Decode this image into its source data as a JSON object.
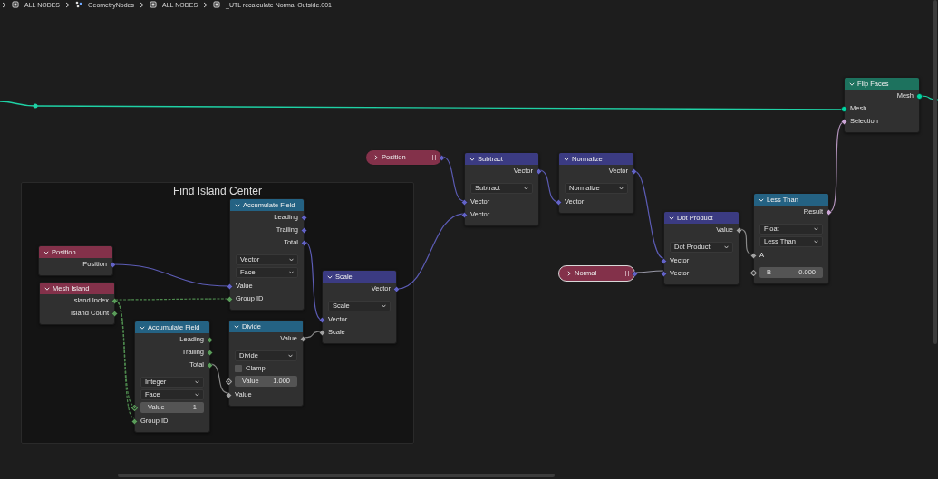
{
  "breadcrumbs": [
    {
      "label": "ALL NODES"
    },
    {
      "label": "GeometryNodes"
    },
    {
      "label": "ALL NODES"
    },
    {
      "label": "_UTL recalculate Normal Outside.001"
    }
  ],
  "frame": {
    "label": "Find Island Center"
  },
  "nodes": [
    {
      "kind": "node",
      "title": "Flip Faces",
      "color": "#1d725e",
      "rows": [
        {
          "kind": "output",
          "label": "Mesh",
          "socket": {
            "kind": "circle",
            "color": "#00d6a3"
          }
        },
        {
          "kind": "input",
          "label": "Mesh",
          "socket": {
            "kind": "circle",
            "color": "#00d6a3"
          }
        },
        {
          "kind": "input",
          "label": "Selection",
          "socket": {
            "kind": "diamond",
            "color": "#cca6d6"
          }
        }
      ]
    },
    {
      "kind": "pill",
      "title": "Position",
      "color": "#83314a",
      "selected": false,
      "socket": {
        "kind": "diamond",
        "color": "#6363c7"
      }
    },
    {
      "kind": "node",
      "title": "Subtract",
      "color": "#3b3b82",
      "rows": [
        {
          "kind": "output",
          "label": "Vector",
          "socket": {
            "kind": "diamond",
            "color": "#6363c7"
          }
        },
        {
          "kind": "dropdown",
          "value": "Subtract"
        },
        {
          "kind": "input",
          "label": "Vector",
          "socket": {
            "kind": "diamond",
            "color": "#6363c7"
          }
        },
        {
          "kind": "input",
          "label": "Vector",
          "socket": {
            "kind": "diamond",
            "color": "#6363c7"
          }
        }
      ]
    },
    {
      "kind": "node",
      "title": "Normalize",
      "color": "#3b3b82",
      "rows": [
        {
          "kind": "output",
          "label": "Vector",
          "socket": {
            "kind": "diamond",
            "color": "#6363c7"
          }
        },
        {
          "kind": "dropdown",
          "value": "Normalize"
        },
        {
          "kind": "input",
          "label": "Vector",
          "socket": {
            "kind": "diamond",
            "color": "#6363c7"
          }
        }
      ]
    },
    {
      "kind": "node",
      "title": "Accumulate Field",
      "color": "#246283",
      "rows": [
        {
          "kind": "output",
          "label": "Leading",
          "socket": {
            "kind": "diamond",
            "color": "#6363c7"
          }
        },
        {
          "kind": "output",
          "label": "Trailing",
          "socket": {
            "kind": "diamond",
            "color": "#6363c7"
          }
        },
        {
          "kind": "output",
          "label": "Total",
          "socket": {
            "kind": "diamond",
            "color": "#6363c7"
          }
        },
        {
          "kind": "dropdown",
          "value": "Vector"
        },
        {
          "kind": "dropdown",
          "value": "Face"
        },
        {
          "kind": "input",
          "label": "Value",
          "socket": {
            "kind": "diamond",
            "color": "#6363c7"
          }
        },
        {
          "kind": "input",
          "label": "Group ID",
          "socket": {
            "kind": "diamond",
            "color": "#5a9c5a"
          }
        }
      ]
    },
    {
      "kind": "node",
      "title": "Position",
      "color": "#83314a",
      "rows": [
        {
          "kind": "output",
          "label": "Position",
          "socket": {
            "kind": "diamond",
            "color": "#6363c7"
          }
        }
      ]
    },
    {
      "kind": "node",
      "title": "Mesh Island",
      "color": "#83314a",
      "rows": [
        {
          "kind": "output",
          "label": "Island Index",
          "socket": {
            "kind": "diamond",
            "color": "#5a9c5a"
          }
        },
        {
          "kind": "output",
          "label": "Island Count",
          "socket": {
            "kind": "diamond",
            "color": "#5a9c5a"
          }
        }
      ]
    },
    {
      "kind": "node",
      "title": "Scale",
      "color": "#3b3b82",
      "rows": [
        {
          "kind": "output",
          "label": "Vector",
          "socket": {
            "kind": "diamond",
            "color": "#6363c7"
          }
        },
        {
          "kind": "dropdown",
          "value": "Scale"
        },
        {
          "kind": "input",
          "label": "Vector",
          "socket": {
            "kind": "diamond",
            "color": "#6363c7"
          }
        },
        {
          "kind": "input",
          "label": "Scale",
          "socket": {
            "kind": "diamond",
            "color": "#a1a1a1"
          }
        }
      ]
    },
    {
      "kind": "node",
      "title": "Accumulate Field",
      "color": "#246283",
      "rows": [
        {
          "kind": "output",
          "label": "Leading",
          "socket": {
            "kind": "diamond",
            "color": "#5a9c5a"
          }
        },
        {
          "kind": "output",
          "label": "Trailing",
          "socket": {
            "kind": "diamond",
            "color": "#5a9c5a"
          }
        },
        {
          "kind": "output",
          "label": "Total",
          "socket": {
            "kind": "diamond",
            "color": "#5a9c5a"
          }
        },
        {
          "kind": "dropdown",
          "value": "Integer"
        },
        {
          "kind": "dropdown",
          "value": "Face"
        },
        {
          "kind": "field",
          "label": "Value",
          "value": "1",
          "socket": {
            "kind": "hollow",
            "color": "#5a9c5a"
          }
        },
        {
          "kind": "input",
          "label": "Group ID",
          "socket": {
            "kind": "diamond",
            "color": "#5a9c5a"
          }
        }
      ]
    },
    {
      "kind": "node",
      "title": "Divide",
      "color": "#246283",
      "rows": [
        {
          "kind": "output",
          "label": "Value",
          "socket": {
            "kind": "diamond",
            "color": "#a1a1a1"
          }
        },
        {
          "kind": "dropdown",
          "value": "Divide"
        },
        {
          "kind": "checkbox",
          "label": "Clamp",
          "checked": false
        },
        {
          "kind": "field",
          "label": "Value",
          "value": "1.000",
          "socket": {
            "kind": "hollow",
            "color": "#a1a1a1"
          }
        },
        {
          "kind": "input",
          "label": "Value",
          "socket": {
            "kind": "diamond",
            "color": "#a1a1a1"
          }
        }
      ]
    },
    {
      "kind": "pill",
      "title": "Normal",
      "color": "#83314a",
      "selected": true,
      "socket": {
        "kind": "diamond",
        "color": "#6363c7"
      }
    },
    {
      "kind": "node",
      "title": "Dot Product",
      "color": "#3b3b82",
      "rows": [
        {
          "kind": "output",
          "label": "Value",
          "socket": {
            "kind": "diamond",
            "color": "#a1a1a1"
          }
        },
        {
          "kind": "dropdown",
          "value": "Dot Product"
        },
        {
          "kind": "input",
          "label": "Vector",
          "socket": {
            "kind": "diamond",
            "color": "#6363c7"
          }
        },
        {
          "kind": "input",
          "label": "Vector",
          "socket": {
            "kind": "diamond",
            "color": "#6363c7"
          }
        }
      ]
    },
    {
      "kind": "node",
      "title": "Less Than",
      "color": "#246283",
      "rows": [
        {
          "kind": "output",
          "label": "Result",
          "socket": {
            "kind": "diamond",
            "color": "#cca6d6"
          }
        },
        {
          "kind": "dropdown",
          "value": "Float"
        },
        {
          "kind": "dropdown",
          "value": "Less Than"
        },
        {
          "kind": "input",
          "label": "A",
          "socket": {
            "kind": "diamond",
            "color": "#a1a1a1"
          }
        },
        {
          "kind": "field",
          "label": "B",
          "value": "0.000",
          "socket": {
            "kind": "hollow",
            "color": "#a1a1a1"
          }
        }
      ]
    }
  ]
}
